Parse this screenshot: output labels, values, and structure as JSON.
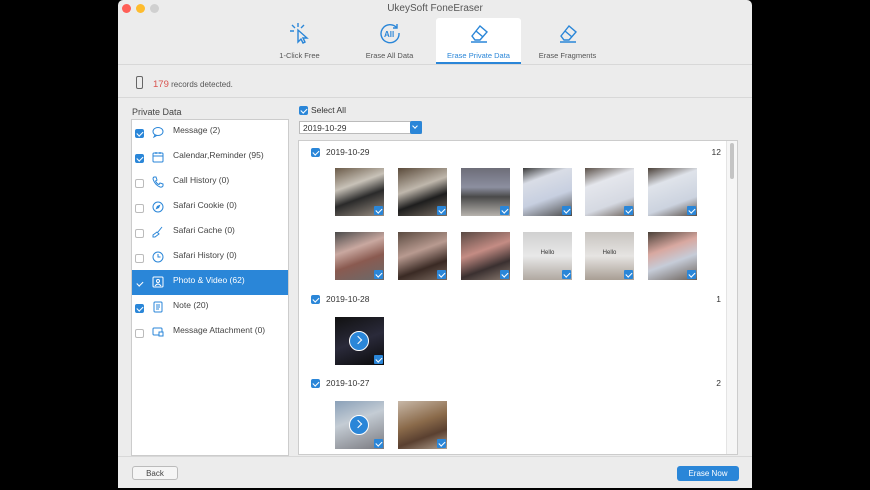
{
  "window": {
    "title": "UkeySoft FoneEraser"
  },
  "toolbar": {
    "tools": [
      {
        "label": "1-Click Free",
        "icon": "cursor-click-icon",
        "active": false
      },
      {
        "label": "Erase All Data",
        "icon": "erase-all-icon",
        "active": false
      },
      {
        "label": "Erase Private Data",
        "icon": "eraser-icon",
        "active": true
      },
      {
        "label": "Erase Fragments",
        "icon": "eraser-icon",
        "active": false
      }
    ]
  },
  "info": {
    "count": "179",
    "suffix": "records detected."
  },
  "sidebar": {
    "title": "Private Data",
    "items": [
      {
        "label": "Message (2)",
        "checked": true,
        "icon": "message-icon"
      },
      {
        "label": "Calendar,Reminder (95)",
        "checked": true,
        "icon": "calendar-icon"
      },
      {
        "label": "Call History (0)",
        "checked": false,
        "icon": "phone-icon"
      },
      {
        "label": "Safari Cookie (0)",
        "checked": false,
        "icon": "compass-icon"
      },
      {
        "label": "Safari Cache (0)",
        "checked": false,
        "icon": "brush-icon"
      },
      {
        "label": "Safari History (0)",
        "checked": false,
        "icon": "clock-icon"
      },
      {
        "label": "Photo & Video (62)",
        "checked": true,
        "icon": "photo-icon",
        "active": true
      },
      {
        "label": "Note (20)",
        "checked": true,
        "icon": "note-icon"
      },
      {
        "label": "Message Attachment (0)",
        "checked": false,
        "icon": "attachment-icon"
      }
    ]
  },
  "content": {
    "select_all": "Select All",
    "date_filter": "2019-10-29",
    "groups": [
      {
        "date": "2019-10-29",
        "count": "12"
      },
      {
        "date": "2019-10-28",
        "count": "1"
      },
      {
        "date": "2019-10-27",
        "count": "2"
      }
    ],
    "hello_text": "Hello"
  },
  "footer": {
    "back": "Back",
    "erase": "Erase Now"
  },
  "colors": {
    "accent": "#2a86d8",
    "count": "#d9534f"
  }
}
